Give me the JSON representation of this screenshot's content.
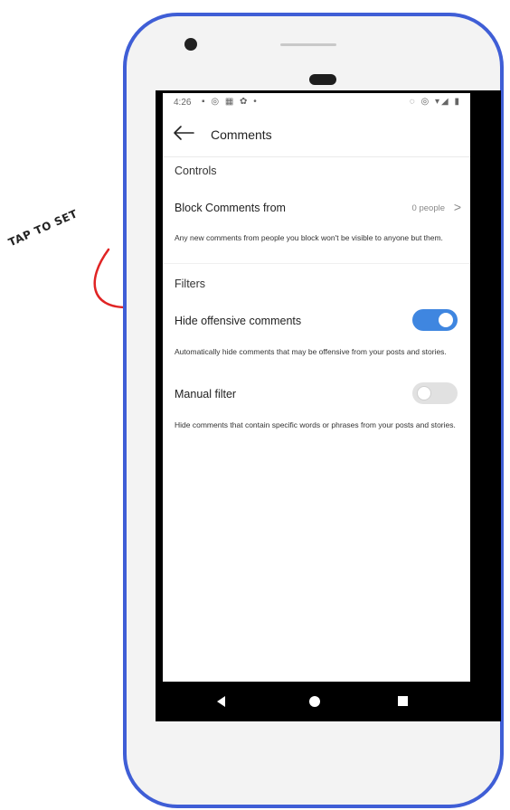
{
  "status_bar": {
    "time": "4:26",
    "left_icons": "▪ ◎ ▦ ✿ •",
    "right_icons": "◌ ◎ ▾◢ ▮"
  },
  "app_bar": {
    "title": "Comments",
    "back_icon": "arrow-left-icon"
  },
  "controls": {
    "section_title": "Controls",
    "block_label": "Block Comments from",
    "block_value": "0 people",
    "block_chevron": ">",
    "block_desc": "Any new comments from people you block won't be visible to anyone but them."
  },
  "filters": {
    "section_title": "Filters",
    "hide_offensive_label": "Hide offensive comments",
    "hide_offensive_on": true,
    "hide_offensive_desc": "Automatically hide comments that may be offensive from your posts and stories.",
    "manual_label": "Manual filter",
    "manual_on": false,
    "manual_desc": "Hide comments that contain specific words or phrases from your posts and stories."
  },
  "annotation": {
    "text": "TAP TO SET"
  },
  "colors": {
    "phone_frame": "#3f5ed6",
    "toggle_on": "#3f86e0",
    "annotation_arrow": "#e02424"
  }
}
